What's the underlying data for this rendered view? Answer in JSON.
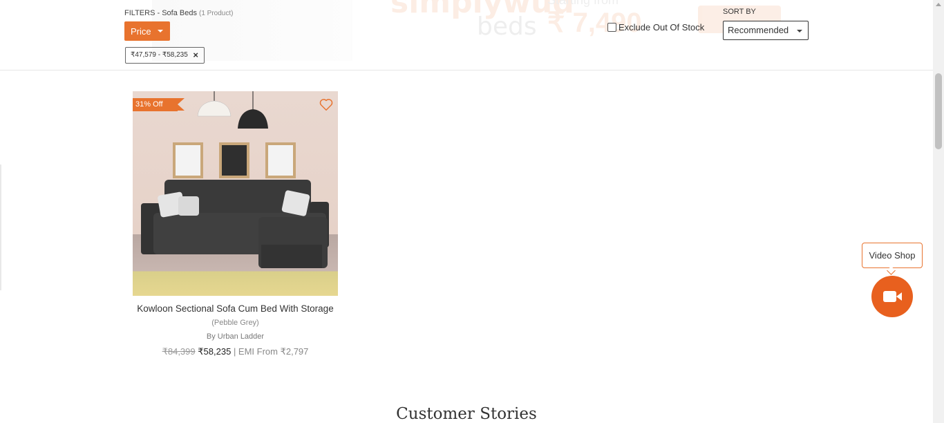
{
  "filters": {
    "label": "FILTERS - Sofa Beds",
    "count": "(1 Product)",
    "price_button": "Price",
    "active_chip": "₹47,579 - ₹58,235",
    "chip_remove": "×",
    "exclude_out_of_stock": "Exclude Out Of Stock"
  },
  "sort": {
    "label": "SORT BY",
    "selected": "Recommended"
  },
  "banner": {
    "title": "simplywud",
    "subtitle": "beds",
    "from": "Starting from",
    "price": "₹ 7,490"
  },
  "product": {
    "badge": "31% Off",
    "name": "Kowloon Sectional Sofa Cum Bed With Storage",
    "variant": "(Pebble Grey)",
    "brand": "By Urban Ladder",
    "old_price": "₹84,399",
    "new_price": "₹58,235",
    "emi": "| EMI From ₹2,797"
  },
  "section": {
    "customer_stories": "Customer Stories"
  },
  "video_shop": {
    "label": "Video Shop",
    "icon": "video-camera-icon"
  },
  "colors": {
    "accent": "#e8732e",
    "video_button": "#e8601e"
  }
}
